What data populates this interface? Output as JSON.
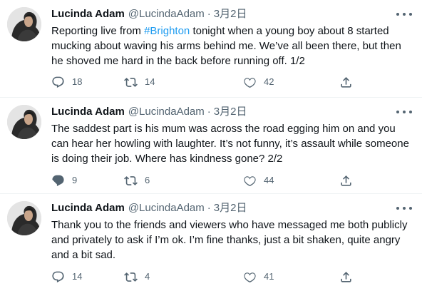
{
  "tweets": [
    {
      "name": "Lucinda Adam",
      "handle": "@LucindaAdam",
      "separator": "·",
      "date": "3月2日",
      "text_before": "Reporting live from ",
      "hashtag": "#Brighton",
      "text_after": " tonight when a young boy about 8 started mucking about waving his arms behind me. We’ve all been there, but then he shoved me hard in the back before running off. 1/2",
      "replies": "18",
      "retweets": "14",
      "likes": "42"
    },
    {
      "name": "Lucinda Adam",
      "handle": "@LucindaAdam",
      "separator": "·",
      "date": "3月2日",
      "text": "The saddest part is his mum was across the road egging him on and you can hear her howling with laughter. It’s not funny, it’s assault while someone is doing their job. Where has kindness gone? 2/2",
      "replies": "9",
      "retweets": "6",
      "likes": "44"
    },
    {
      "name": "Lucinda Adam",
      "handle": "@LucindaAdam",
      "separator": "·",
      "date": "3月2日",
      "text": "Thank you to the friends and viewers who have messaged me both publicly and privately to ask if I’m ok. I’m fine thanks, just a bit shaken, quite angry and a bit sad.",
      "replies": "14",
      "retweets": "4",
      "likes": "41"
    }
  ],
  "icons": {
    "reply": "reply-icon",
    "retweet": "retweet-icon",
    "like": "heart-icon",
    "share": "share-icon",
    "more": "more-icon"
  },
  "colors": {
    "text": "#0f1419",
    "secondary": "#536471",
    "hashtag": "#1d9bf0",
    "divider": "#eff3f4"
  }
}
